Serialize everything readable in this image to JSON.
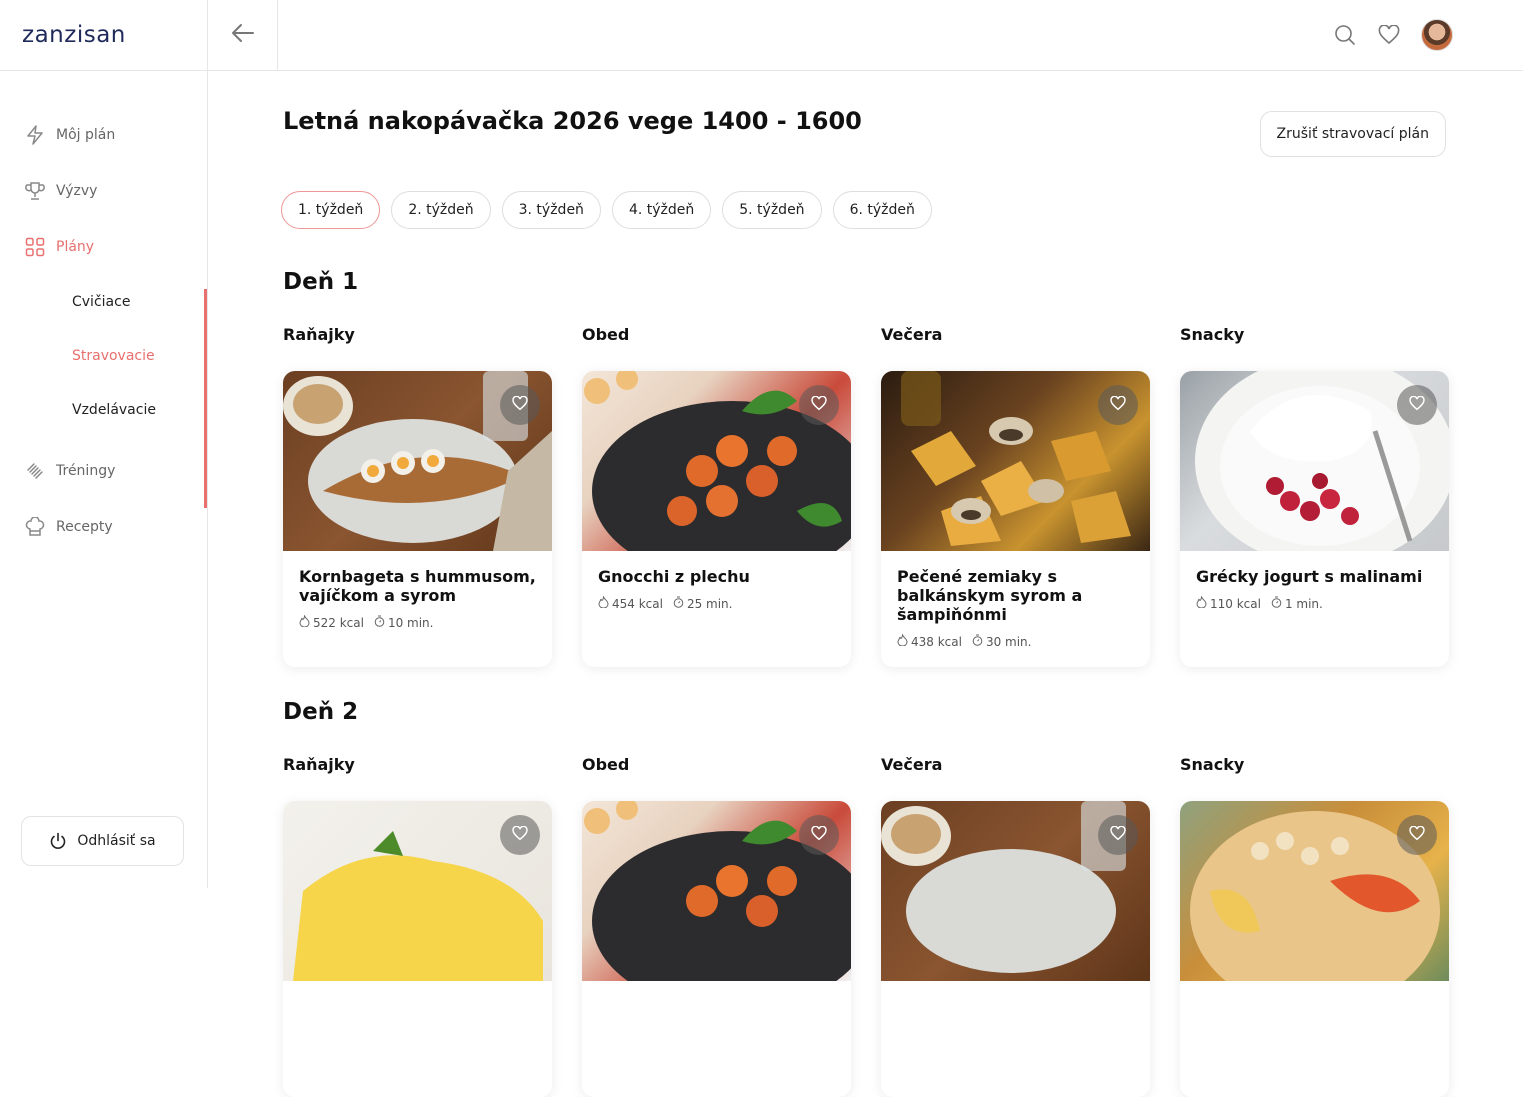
{
  "app": {
    "logo": "zanzisan"
  },
  "sidebar": {
    "items": [
      {
        "label": "Môj plán",
        "icon": "lightning-icon"
      },
      {
        "label": "Výzvy",
        "icon": "trophy-icon"
      },
      {
        "label": "Plány",
        "icon": "grid-icon"
      },
      {
        "label": "Tréningy",
        "icon": "dumbbell-icon"
      },
      {
        "label": "Recepty",
        "icon": "chef-hat-icon"
      }
    ],
    "sub_items": [
      "Cvičiace",
      "Stravovacie",
      "Vzdelávacie"
    ],
    "logout_label": "Odhlásiť sa"
  },
  "topbar": {
    "icons": [
      "back-arrow-icon",
      "search-icon",
      "heart-icon",
      "avatar"
    ]
  },
  "main": {
    "title": "Letná nakopávačka 2026 vege 1400 - 1600",
    "cancel_label": "Zrušiť stravovací plán",
    "weeks": [
      "1. týždeň",
      "2. týždeň",
      "3. týždeň",
      "4. týždeň",
      "5. týždeň",
      "6. týždeň"
    ],
    "days": [
      {
        "title": "Deň 1",
        "meals": [
          {
            "label": "Raňajky",
            "title": "Kornbageta s hummusom, vajíčkom a syrom",
            "kcal": "522 kcal",
            "time": "10 min."
          },
          {
            "label": "Obed",
            "title": "Gnocchi z plechu",
            "kcal": "454 kcal",
            "time": "25 min."
          },
          {
            "label": "Večera",
            "title": "Pečené zemiaky s balkánskym syrom a šampiňónmi",
            "kcal": "438 kcal",
            "time": "30 min."
          },
          {
            "label": "Snacky",
            "title": "Grécky jogurt s malinami",
            "kcal": "110 kcal",
            "time": "1 min."
          }
        ]
      },
      {
        "title": "Deň 2",
        "meals": [
          {
            "label": "Raňajky"
          },
          {
            "label": "Obed"
          },
          {
            "label": "Večera"
          },
          {
            "label": "Snacky"
          }
        ]
      }
    ]
  },
  "colors": {
    "accent": "#e8706e",
    "brand": "#1f2a5a"
  }
}
